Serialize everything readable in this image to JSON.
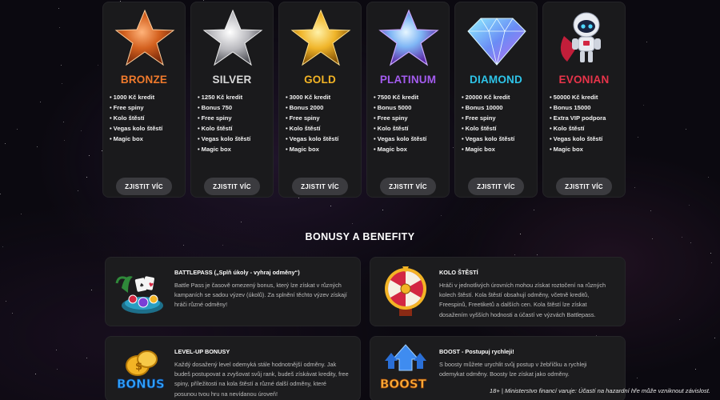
{
  "tiers": [
    {
      "name": "BRONZE",
      "color": "#f07a2c",
      "items": [
        "1000 Kč kredit",
        "Free spiny",
        "Kolo štěstí",
        "Vegas kolo štěstí",
        "Magic box"
      ],
      "button": "ZJISTIT VÍC",
      "icon": "bronze-star-icon"
    },
    {
      "name": "SILVER",
      "color": "#d9d9d9",
      "items": [
        "1250 Kč kredit",
        "Bonus 750",
        "Free spiny",
        "Kolo štěstí",
        "Vegas kolo štěstí",
        "Magic box"
      ],
      "button": "ZJISTIT VÍC",
      "icon": "silver-star-icon"
    },
    {
      "name": "GOLD",
      "color": "#f3b425",
      "items": [
        "3000 Kč kredit",
        "Bonus 2000",
        "Free spiny",
        "Kolo štěstí",
        "Vegas kolo štěstí",
        "Magic box"
      ],
      "button": "ZJISTIT VÍC",
      "icon": "gold-star-icon"
    },
    {
      "name": "PLATINUM",
      "color": "#a45cf0",
      "items": [
        "7500 Kč kredit",
        "Bonus 5000",
        "Free spiny",
        "Kolo štěstí",
        "Vegas kolo štěstí",
        "Magic box"
      ],
      "button": "ZJISTIT VÍC",
      "icon": "platinum-star-icon"
    },
    {
      "name": "DIAMOND",
      "color": "#2ec4e8",
      "items": [
        "20000 Kč kredit",
        "Bonus 10000",
        "Free spiny",
        "Kolo štěstí",
        "Vegas kolo štěstí",
        "Magic box"
      ],
      "button": "ZJISTIT VÍC",
      "icon": "diamond-icon"
    },
    {
      "name": "EVONIAN",
      "color": "#e8344a",
      "items": [
        "50000 Kč kredit",
        "Bonus 15000",
        "Extra VIP podpora",
        "Kolo štěstí",
        "Vegas kolo štěstí",
        "Magic box"
      ],
      "button": "ZJISTIT VÍC",
      "icon": "robot-mascot-icon"
    }
  ],
  "section_title": "BONUSY A BENEFITY",
  "bonuses": [
    {
      "title": "BATTLEPASS („Splň úkoly - vyhraj odměny“)",
      "desc": "Battle Pass je časově omezený bonus, který lze získat v různých kampaních se sadou výzev (úkolů). Za splnění těchto výzev získají hráči různé odměny!",
      "icon": "battlepass-casino-icon"
    },
    {
      "title": "KOLO ŠTĚSTÍ",
      "desc": "Hráči v jednotlivých úrovních mohou získat roztočení na různých kolech štěstí. Kola štěstí obsahují odměny, včetně kreditů, Freespinů, Freetiketů a dalších cen. Kola štěstí lze získat dosažením vyšších hodnosti a účastí ve výzvách Battlepass.",
      "icon": "wheel-of-fortune-icon"
    },
    {
      "title": "LEVEL-UP BONUSY",
      "desc": "Každý dosažený level odemyká stále hodnotnější odměny. Jak budeš postupovat a zvyšovat svůj rank, budeš získávat kredity, free spiny, příležitosti na kola štěstí a různé další odměny, které posunou tvou hru na nevídanou úroveň!",
      "icon": "bonus-coins-icon",
      "icon_text": "BONUS"
    },
    {
      "title": "BOOST - Postupuj rychleji!",
      "desc": "S boosty můžete urychlit svůj postup v žebříčku a rychleji odemykat odměny. Boosty lze získat jako odměny.",
      "icon": "boost-arrow-icon",
      "icon_text": "BOOST"
    }
  ],
  "footer": "18+ | Ministerstvo financí varuje: Účastí na hazardní hře může vzniknout závislost."
}
